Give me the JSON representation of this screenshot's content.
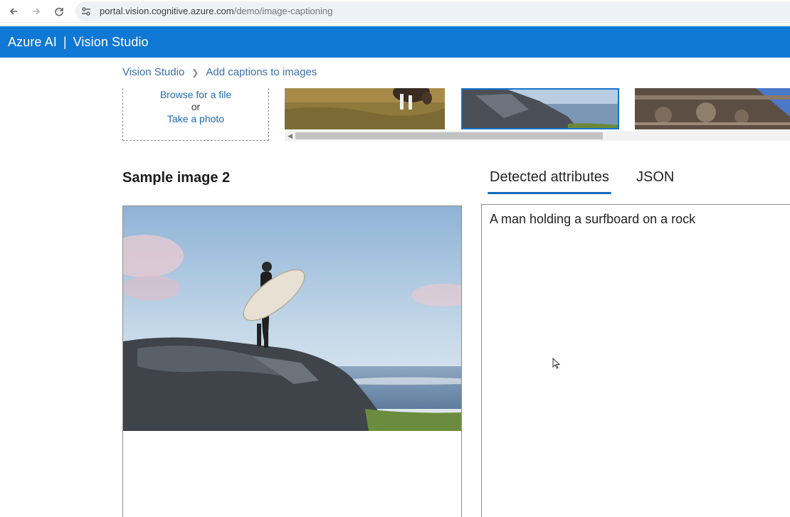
{
  "browser": {
    "url_domain": "portal.vision.cognitive.azure.com",
    "url_path": "/demo/image-captioning"
  },
  "header": {
    "brand": "Azure AI",
    "separator": "|",
    "product": "Vision Studio"
  },
  "breadcrumb": {
    "items": [
      "Vision Studio",
      "Add captions to images"
    ]
  },
  "upload": {
    "browse_label": "Browse for a file",
    "or_label": "or",
    "photo_label": "Take a photo"
  },
  "sample": {
    "title": "Sample image 2"
  },
  "tabs": [
    {
      "label": "Detected attributes",
      "active": true
    },
    {
      "label": "JSON",
      "active": false
    }
  ],
  "result": {
    "caption": "A man holding a surfboard on a rock"
  },
  "colors": {
    "header_bg": "#0f78d4",
    "accent": "#0f6cbd",
    "link": "#1e6ab3"
  }
}
